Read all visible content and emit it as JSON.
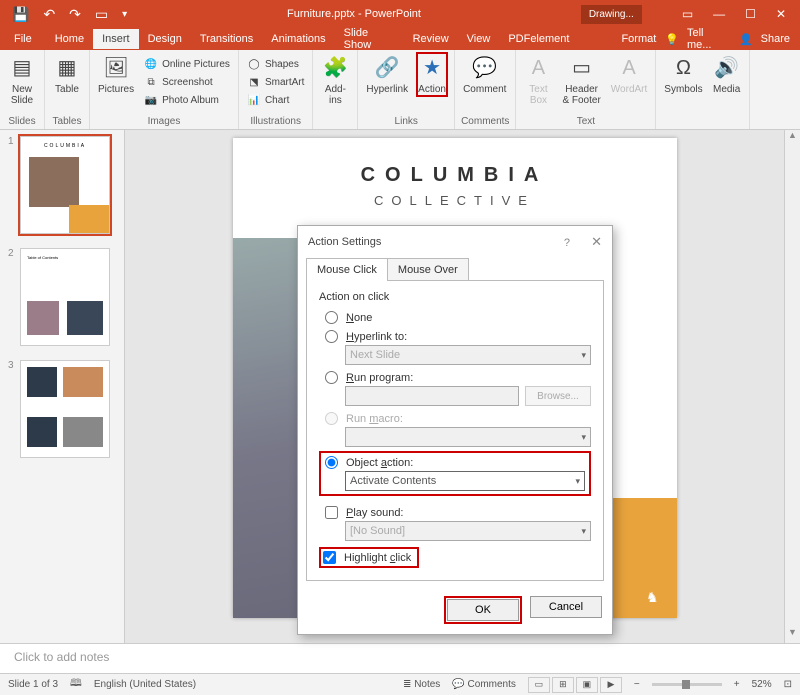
{
  "titlebar": {
    "docname": "Furniture.pptx - PowerPoint",
    "drawing": "Drawing..."
  },
  "menu": {
    "file": "File",
    "home": "Home",
    "insert": "Insert",
    "design": "Design",
    "transitions": "Transitions",
    "animations": "Animations",
    "slideshow": "Slide Show",
    "review": "Review",
    "view": "View",
    "pdfelement": "PDFelement",
    "format": "Format",
    "tellme": "Tell me...",
    "share": "Share"
  },
  "ribbon": {
    "newslide": "New\nSlide",
    "table": "Table",
    "pictures": "Pictures",
    "onlinepics": "Online Pictures",
    "screenshot": "Screenshot",
    "photoalbum": "Photo Album",
    "shapes": "Shapes",
    "smartart": "SmartArt",
    "chart": "Chart",
    "addins": "Add-\nins",
    "hyperlink": "Hyperlink",
    "action": "Action",
    "comment": "Comment",
    "textbox": "Text\nBox",
    "headerfooter": "Header\n& Footer",
    "wordart": "WordArt",
    "symbols": "Symbols",
    "media": "Media",
    "g_slides": "Slides",
    "g_tables": "Tables",
    "g_images": "Images",
    "g_illus": "Illustrations",
    "g_links": "Links",
    "g_comments": "Comments",
    "g_text": "Text"
  },
  "slide": {
    "title": "COLUMBIA",
    "subtitle": "COLLECTIVE"
  },
  "thumbs": {
    "n1": "1",
    "n2": "2",
    "n3": "3"
  },
  "dialog": {
    "title": "Action Settings",
    "tab_click": "Mouse Click",
    "tab_over": "Mouse Over",
    "group": "Action on click",
    "none": "None",
    "hyperlink": "Hyperlink to:",
    "hyperlink_val": "Next Slide",
    "runprog": "Run program:",
    "browse": "Browse...",
    "runmacro": "Run macro:",
    "objectaction": "Object action:",
    "objectaction_val": "Activate Contents",
    "playsound": "Play sound:",
    "playsound_val": "[No Sound]",
    "highlight": "Highlight click",
    "ok": "OK",
    "cancel": "Cancel"
  },
  "notes": {
    "placeholder": "Click to add notes"
  },
  "status": {
    "slide": "Slide 1 of 3",
    "lang": "English (United States)",
    "notes": "Notes",
    "comments": "Comments",
    "zoom": "52%"
  }
}
